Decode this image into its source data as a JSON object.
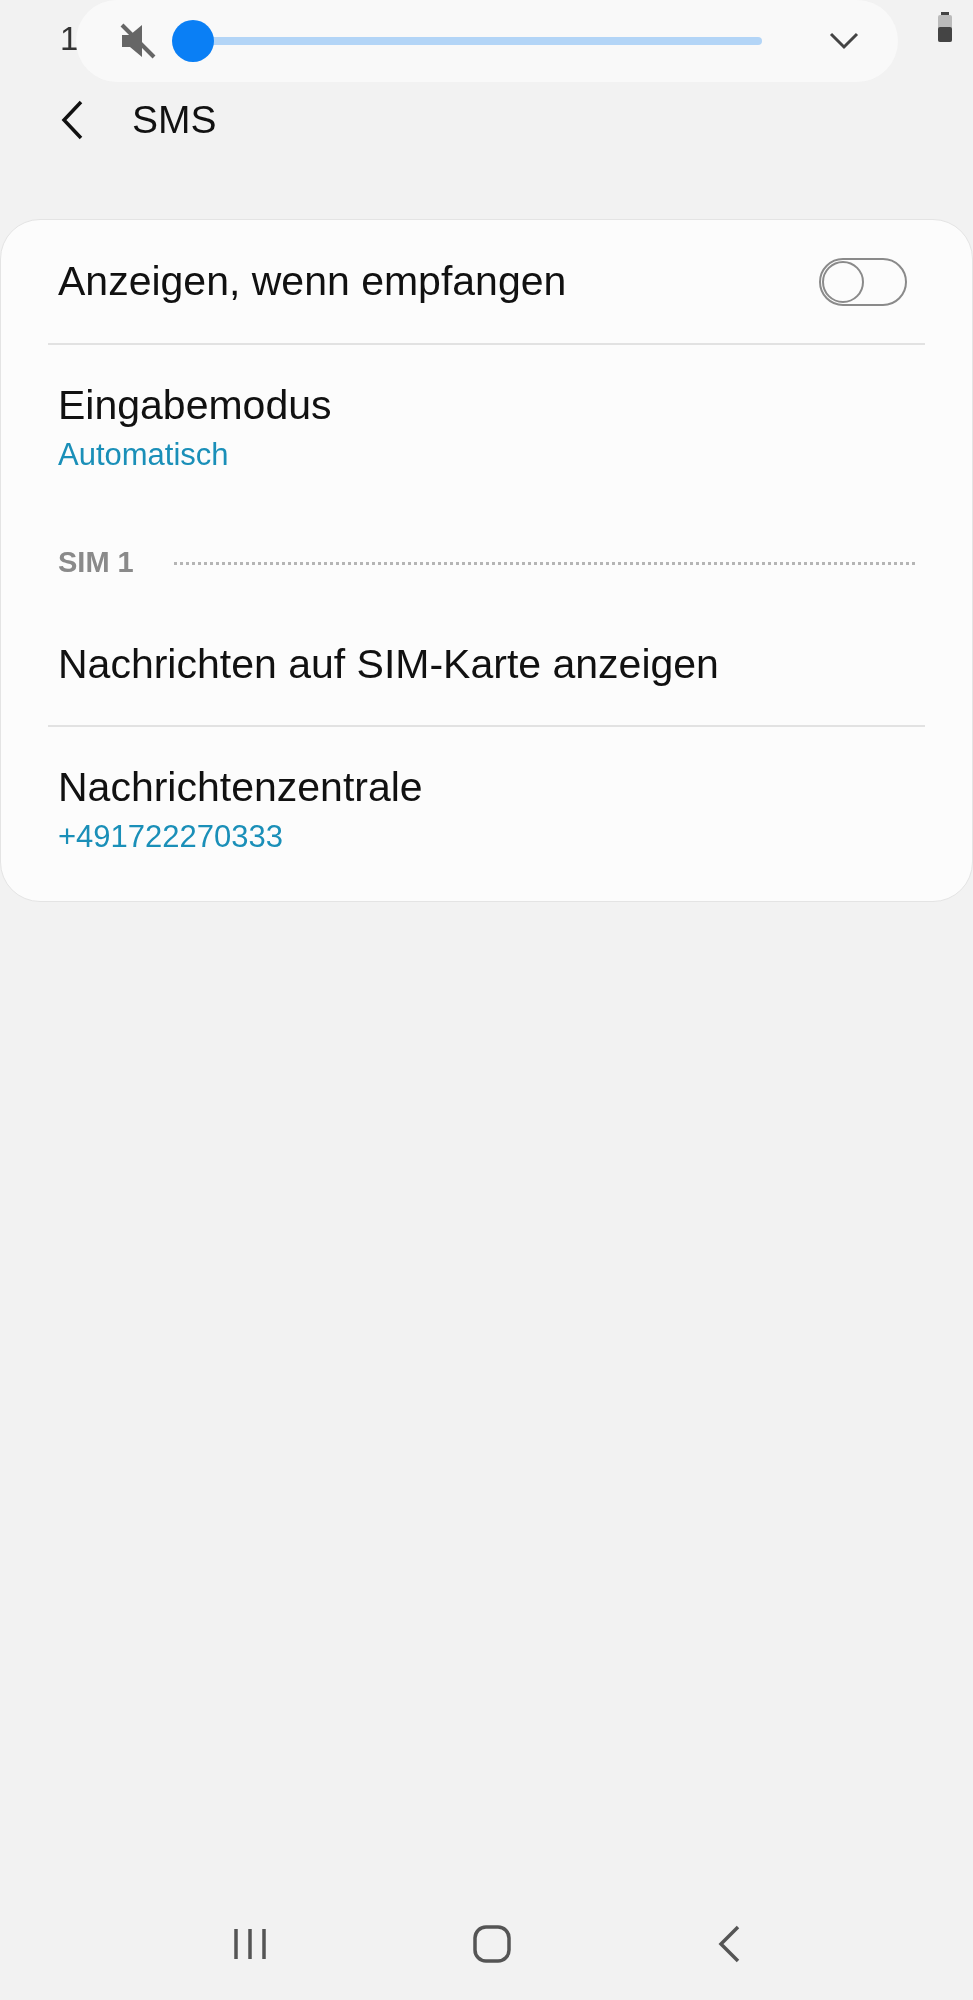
{
  "status_bar": {
    "time": "1"
  },
  "volume_panel": {
    "muted": true,
    "level": 0
  },
  "header": {
    "title": "SMS"
  },
  "settings": [
    {
      "kind": "toggle",
      "title": "Anzeigen, wenn empfangen",
      "on": false
    },
    {
      "kind": "value",
      "title": "Eingabemodus",
      "value": "Automatisch"
    },
    {
      "kind": "section",
      "title": "SIM 1"
    },
    {
      "kind": "plain",
      "title": "Nachrichten auf SIM-Karte anzeigen"
    },
    {
      "kind": "value",
      "title": "Nachrichtenzentrale",
      "value": "+491722270333"
    }
  ]
}
